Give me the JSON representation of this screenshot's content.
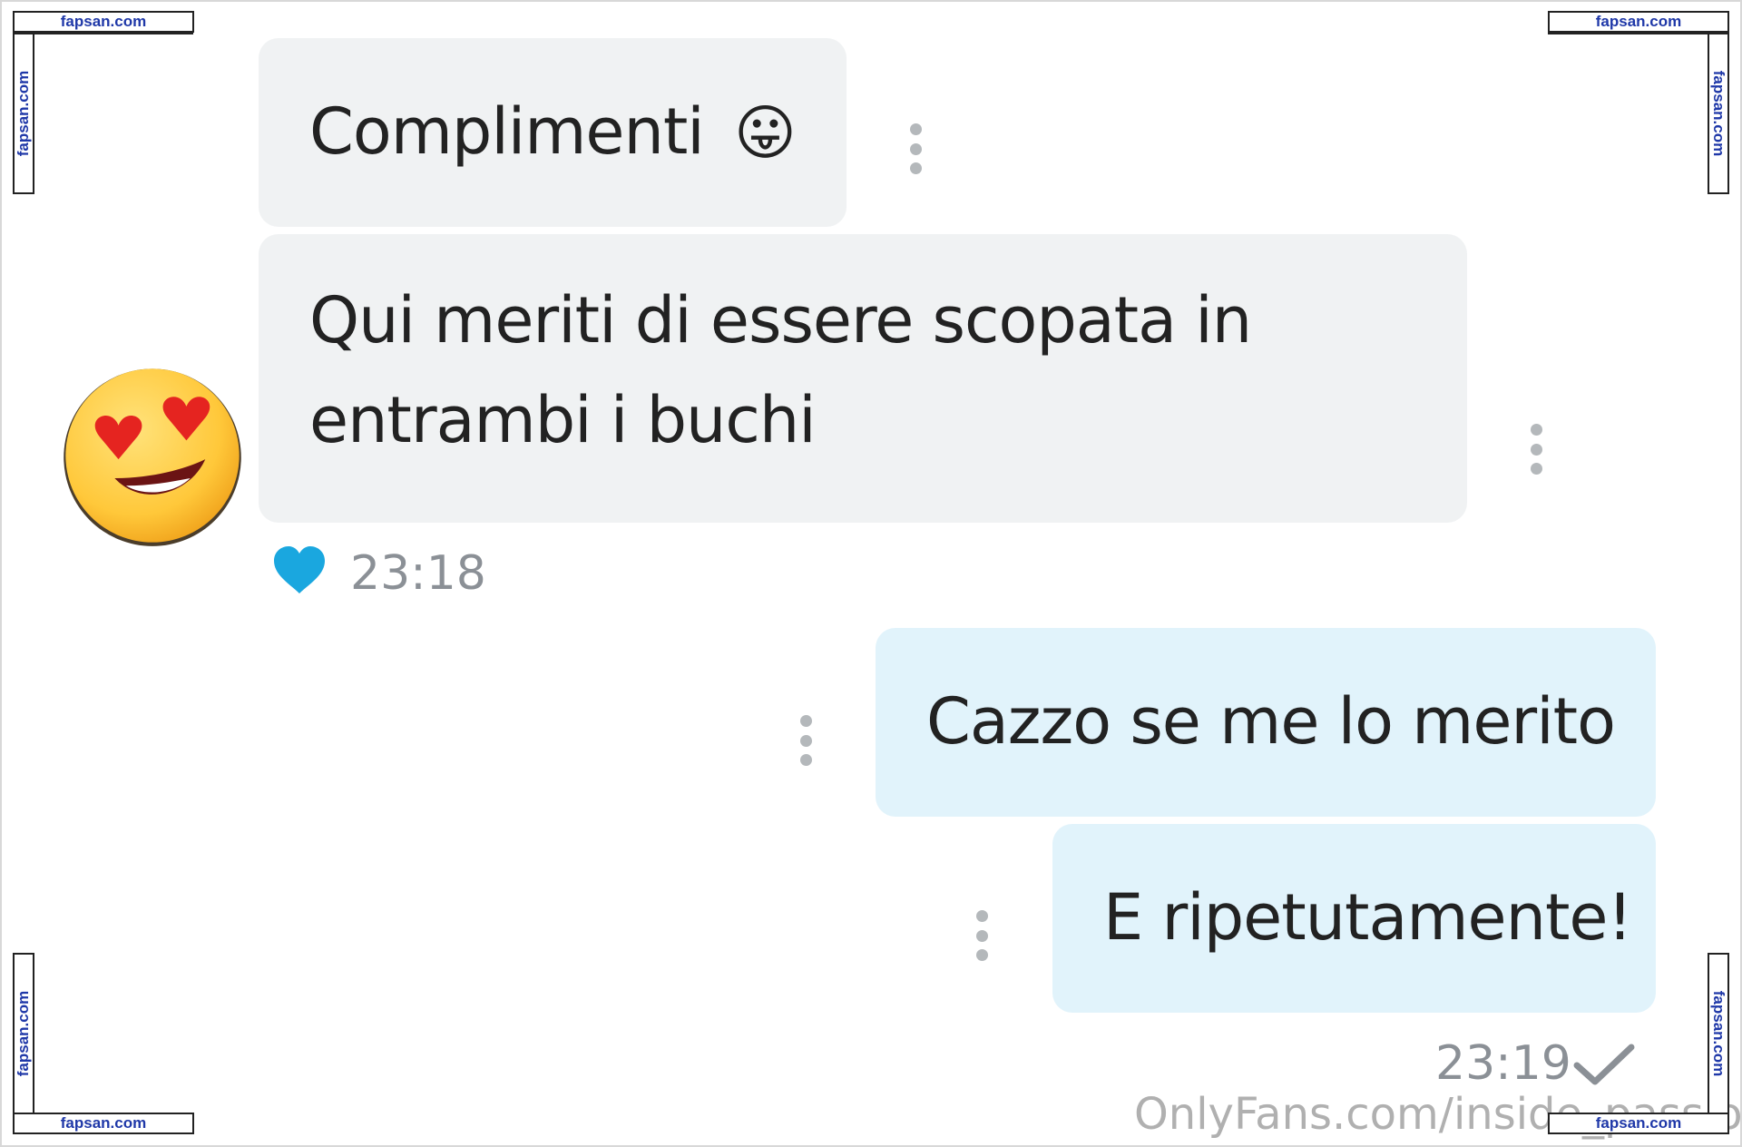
{
  "messages": [
    {
      "direction": "incoming",
      "text": "Complimenti",
      "emoji": "😛"
    },
    {
      "direction": "incoming",
      "text_line1": "Qui meriti di essere scopata in",
      "text_line2": "entrambi i buchi"
    },
    {
      "direction": "outgoing",
      "text": "Cazzo se me lo merito"
    },
    {
      "direction": "outgoing",
      "text": "E ripetutamente!"
    }
  ],
  "incoming_meta": {
    "reaction": "heart-reaction-icon",
    "reaction_color": "#1aa7df",
    "time": "23:18"
  },
  "outgoing_meta": {
    "time": "23:19",
    "status": "checkmark-icon"
  },
  "avatar": {
    "emoji": "😍"
  },
  "watermarks": {
    "site": "fapsan.com",
    "bottom_text": "OnlyFans.com/inside_passion"
  },
  "colors": {
    "incoming_bubble": "#f0f2f3",
    "outgoing_bubble": "#e1f3fb",
    "text": "#222222",
    "meta": "#8b9096",
    "watermark_blue": "#1f38a8"
  }
}
